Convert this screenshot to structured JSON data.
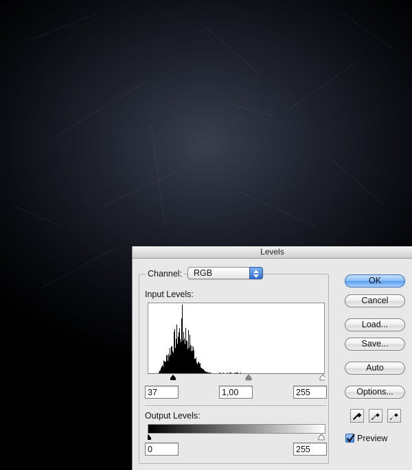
{
  "dialog": {
    "title": "Levels"
  },
  "channel": {
    "label": "Channel:",
    "value": "RGB"
  },
  "input_levels": {
    "label": "Input Levels:",
    "black": "37",
    "gamma": "1,00",
    "white": "255"
  },
  "output_levels": {
    "label": "Output Levels:",
    "black": "0",
    "white": "255"
  },
  "buttons": {
    "ok": "OK",
    "cancel": "Cancel",
    "load": "Load...",
    "save": "Save...",
    "auto": "Auto",
    "options": "Options..."
  },
  "eyedroppers": [
    "eyedropper-black-icon",
    "eyedropper-gray-icon",
    "eyedropper-white-icon"
  ],
  "preview": {
    "label": "Preview",
    "checked": true
  },
  "colors": {
    "accent": "#5a9ff0",
    "dialog_bg": "#e8e8e8",
    "canvas_dark": "#1a1d27"
  }
}
